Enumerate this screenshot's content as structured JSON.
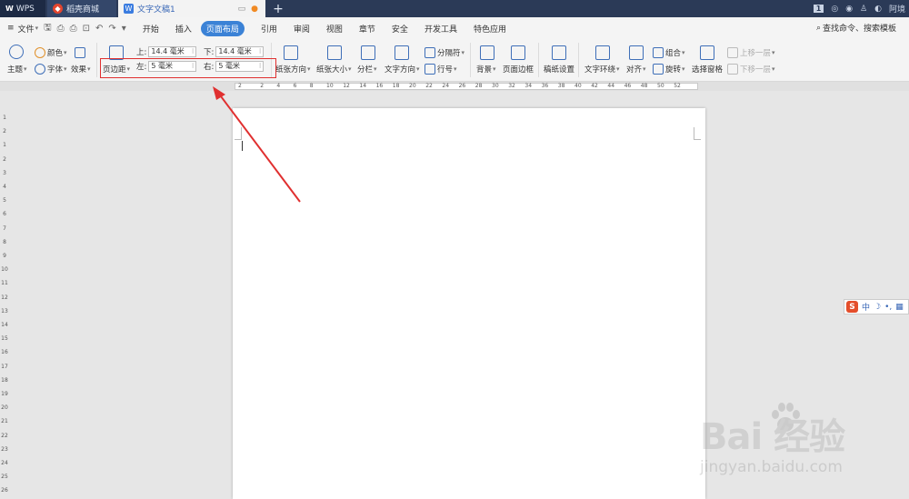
{
  "titlebar": {
    "app_tab": "WPS",
    "store_tab": "稻壳商城",
    "doc_tab": "文字文稿1",
    "new_tab": "+",
    "badge": "1",
    "user": "阿境"
  },
  "menubar": {
    "file": "文件",
    "items": [
      "开始",
      "插入",
      "页面布局",
      "引用",
      "审阅",
      "视图",
      "章节",
      "安全",
      "开发工具",
      "特色应用"
    ],
    "active_index": 2,
    "search": "查找命令、搜索模板"
  },
  "ribbon": {
    "theme": "主题",
    "colors": "颜色",
    "fonts": "字体",
    "effects": "效果",
    "margins": "页边距",
    "top_label": "上:",
    "top_value": "14.4 毫米",
    "bottom_label": "下:",
    "bottom_value": "14.4 毫米",
    "left_label": "左:",
    "left_value": "5 毫米",
    "right_label": "右:",
    "right_value": "5 毫米",
    "orientation": "纸张方向",
    "size": "纸张大小",
    "columns": "分栏",
    "text_direction": "文字方向",
    "breaks": "分隔符",
    "line_numbers": "行号",
    "background": "背景",
    "page_border": "页面边框",
    "paper_settings": "稿纸设置",
    "text_wrap": "文字环绕",
    "align": "对齐",
    "group": "组合",
    "rotate": "旋转",
    "selection_pane": "选择窗格",
    "bring_forward": "上移一层",
    "send_backward": "下移一层"
  },
  "ruler": {
    "h_ticks": [
      "2",
      "2",
      "4",
      "6",
      "8",
      "10",
      "12",
      "14",
      "16",
      "18",
      "20",
      "22",
      "24",
      "26",
      "28",
      "30",
      "32",
      "34",
      "36",
      "38",
      "40",
      "42",
      "44",
      "46",
      "48",
      "50",
      "52"
    ],
    "v_ticks": [
      "1",
      "2",
      "1",
      "2",
      "3",
      "4",
      "5",
      "6",
      "7",
      "8",
      "9",
      "10",
      "11",
      "12",
      "13",
      "14",
      "15",
      "16",
      "17",
      "18",
      "19",
      "20",
      "21",
      "22",
      "23",
      "24",
      "25",
      "26"
    ]
  },
  "ime": {
    "s": "S",
    "mode": "中",
    "moon": "☽",
    "dot": "•,",
    "grid": "▦"
  },
  "watermark": {
    "logo": "Bai  经验",
    "url": "jingyan.baidu.com"
  },
  "colors": {
    "accent": "#3b82d6",
    "titlebar": "#2b3a57",
    "highlight": "#e03030"
  }
}
